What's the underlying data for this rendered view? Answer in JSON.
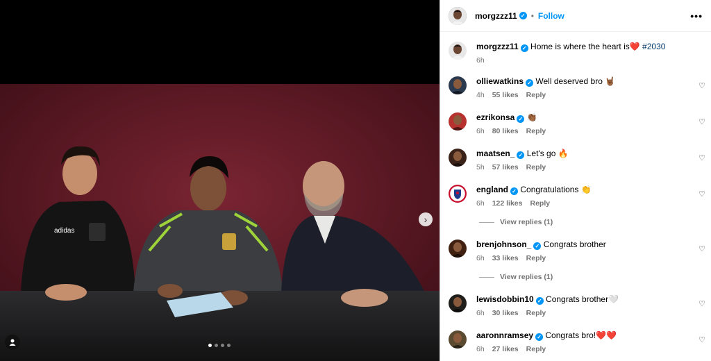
{
  "post": {
    "author": "morgzzz11",
    "follow_label": "Follow",
    "caption": "Home is where the heart is❤️",
    "hashtag": "#2030",
    "caption_time": "6h",
    "carousel_count": 4,
    "carousel_active": 1
  },
  "comments": [
    {
      "user": "olliewatkins",
      "text": "Well deserved bro 🤘🏾",
      "time": "4h",
      "likes": "55 likes",
      "reply": "Reply"
    },
    {
      "user": "ezrikonsa",
      "text": "👏🏾",
      "time": "6h",
      "likes": "80 likes",
      "reply": "Reply"
    },
    {
      "user": "maatsen_",
      "text": "Let's go 🔥",
      "time": "5h",
      "likes": "57 likes",
      "reply": "Reply"
    },
    {
      "user": "england",
      "text": "Congratulations 👏",
      "time": "6h",
      "likes": "122 likes",
      "reply": "Reply",
      "view": "View replies (1)"
    },
    {
      "user": "brenjohnson_",
      "text": "Congrats brother",
      "time": "6h",
      "likes": "33 likes",
      "reply": "Reply",
      "view": "View replies (1)"
    },
    {
      "user": "lewisdobbin10",
      "text": "Congrats brother🤍",
      "time": "6h",
      "likes": "30 likes",
      "reply": "Reply"
    },
    {
      "user": "aaronnramsey",
      "text": "Congrats bro!❤️❤️",
      "time": "6h",
      "likes": "27 likes",
      "reply": "Reply"
    }
  ],
  "icons": {
    "heart": "♡",
    "more": "•••",
    "chevron": "›",
    "verified": "✓"
  }
}
